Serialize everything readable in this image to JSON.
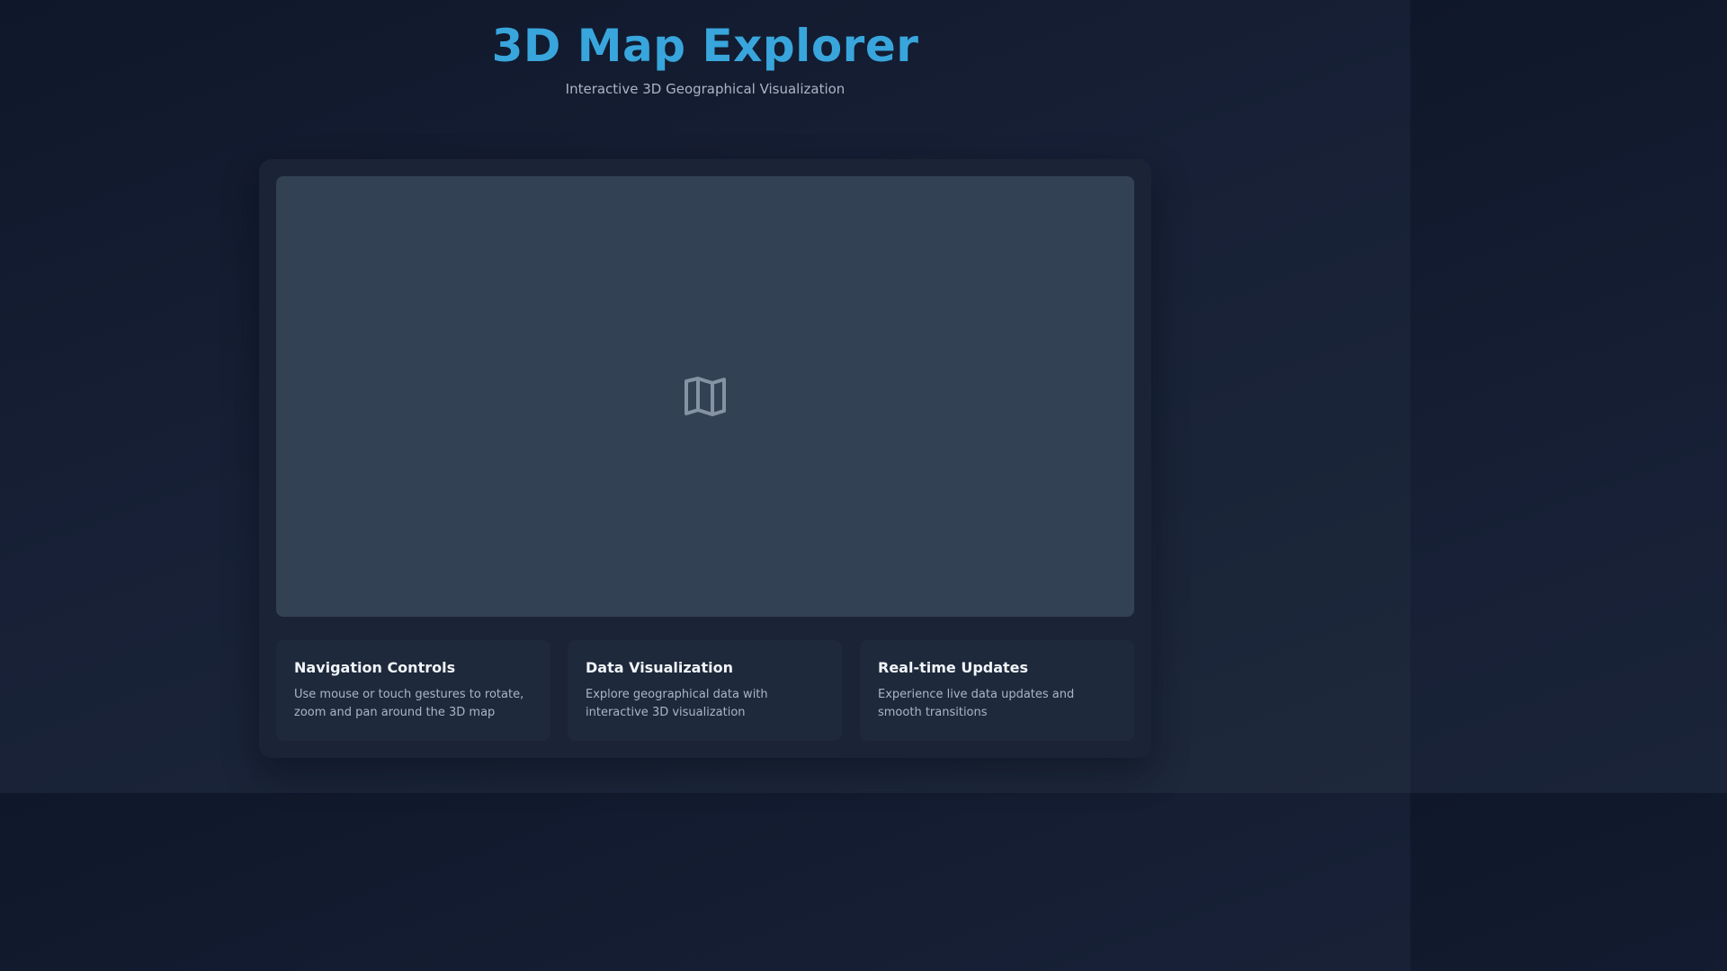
{
  "header": {
    "title": "3D Map Explorer",
    "subtitle": "Interactive 3D Geographical Visualization"
  },
  "map": {
    "icon": "map-icon"
  },
  "cards": [
    {
      "title": "Navigation Controls",
      "text": "Use mouse or touch gestures to rotate, zoom and pan around the 3D map"
    },
    {
      "title": "Data Visualization",
      "text": "Explore geographical data with interactive 3D visualization"
    },
    {
      "title": "Real-time Updates",
      "text": "Experience live data updates and smooth transitions"
    }
  ],
  "colors": {
    "accent": "#38a6dc",
    "background": "#0f172a",
    "panel": "#1b2436",
    "map_surface": "#334155",
    "card": "#1e293b",
    "muted_text": "#aab6c6"
  }
}
